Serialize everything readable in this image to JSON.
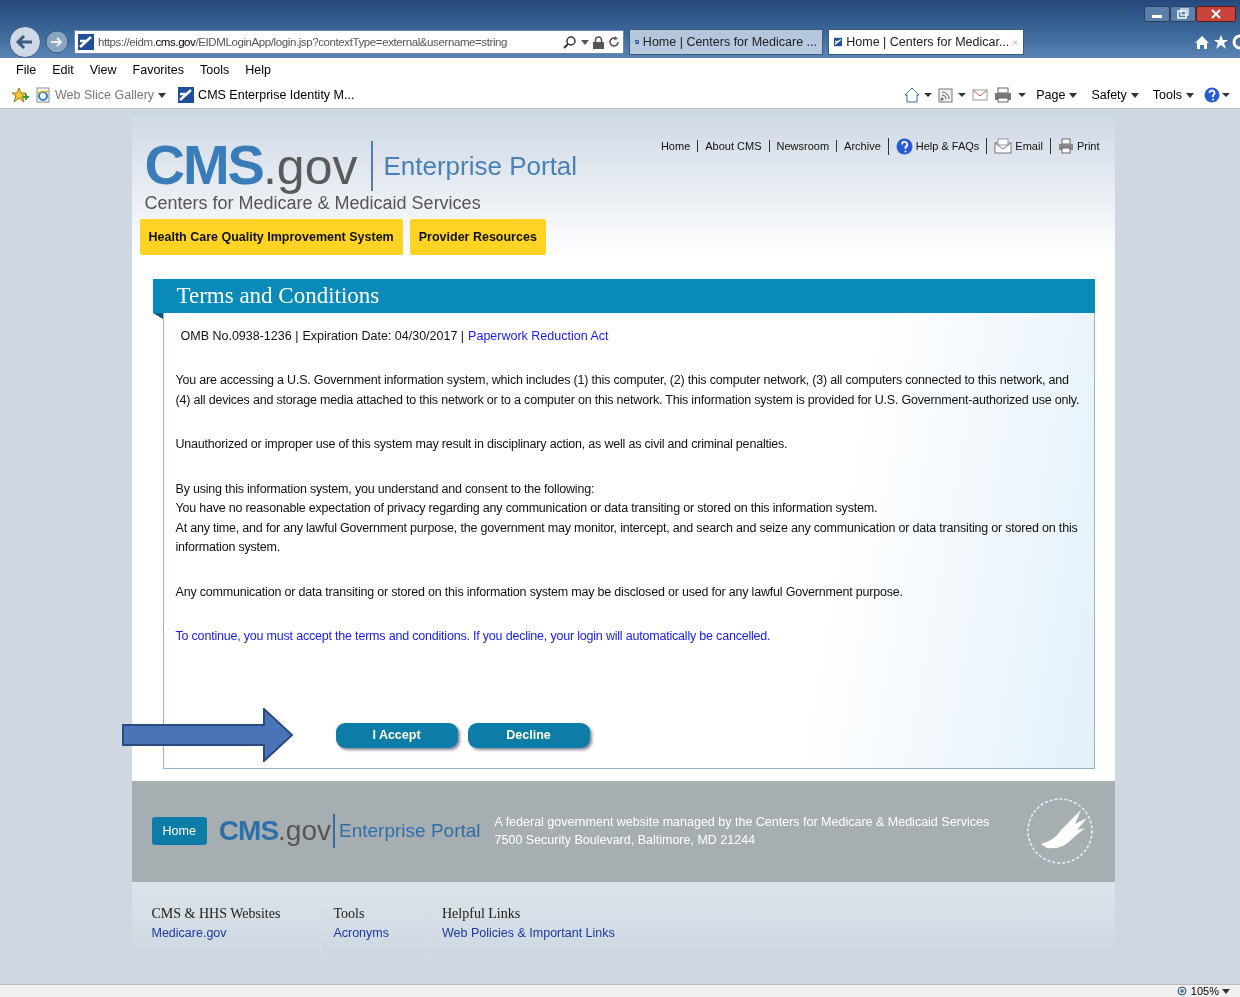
{
  "browser": {
    "address": {
      "prefix": "https://eidm.",
      "domain": "cms.gov",
      "path": "/EIDMLoginApp/login.jsp?contextType=external&username=string"
    },
    "tabs": [
      {
        "title": "Home | Centers for Medicare ...",
        "selected": false
      },
      {
        "title": "Home | Centers for Medicar...",
        "selected": true
      }
    ],
    "menu": [
      "File",
      "Edit",
      "View",
      "Favorites",
      "Tools",
      "Help"
    ],
    "favorites": [
      {
        "label": "Web Slice Gallery",
        "kind": "gallery"
      },
      {
        "label": "CMS Enterprise Identity M...",
        "kind": "site"
      }
    ],
    "commands": [
      "Page",
      "Safety",
      "Tools"
    ]
  },
  "header": {
    "logo": {
      "brand": "CMS",
      "suffix": ".gov",
      "portal": "Enterprise Portal",
      "subtitle": "Centers for Medicare & Medicaid Services"
    },
    "nav": [
      {
        "label": "Home",
        "kind": "text"
      },
      {
        "label": "About CMS",
        "kind": "text"
      },
      {
        "label": "Newsroom",
        "kind": "text"
      },
      {
        "label": "Archive",
        "kind": "text"
      },
      {
        "label": "Help & FAQs",
        "kind": "help"
      },
      {
        "label": "Email",
        "kind": "email"
      },
      {
        "label": "Print",
        "kind": "print"
      }
    ],
    "sections": [
      "Health Care Quality Improvement System",
      "Provider Resources"
    ]
  },
  "terms": {
    "title": "Terms and Conditions",
    "omb": "OMB No.0938-1236 |",
    "expiration": "Expiration Date: 04/30/2017 |",
    "link": "Paperwork Reduction Act",
    "paragraphs": [
      {
        "kind": "text",
        "lines": [
          "You are accessing a U.S. Government information system, which includes (1) this computer, (2) this computer network, (3) all computers connected to this network, and (4) all devices and storage media attached to this network or to a computer on this network. This information system is provided for U.S. Government-authorized use only."
        ]
      },
      {
        "kind": "text",
        "lines": [
          "Unauthorized or improper use of this system may result in disciplinary action, as well as civil and criminal penalties."
        ]
      },
      {
        "kind": "text",
        "lines": [
          "By using this information system, you understand and consent to the following:",
          "You have no reasonable expectation of privacy regarding any communication or data transiting or stored on this information system.",
          "At any time, and for any lawful Government purpose, the government may monitor, intercept, and search and seize any communication or data transiting or stored on this information system."
        ]
      },
      {
        "kind": "text",
        "lines": [
          "Any communication or data transiting or stored on this information system may be disclosed or used for any lawful Government purpose."
        ]
      },
      {
        "kind": "notice",
        "lines": [
          "To continue, you must accept the terms and conditions. If you decline, your login will automatically be cancelled."
        ]
      }
    ],
    "buttons": [
      "I Accept",
      "Decline"
    ]
  },
  "footer": {
    "home": "Home",
    "logo": {
      "brand": "CMS",
      "suffix": ".gov",
      "portal": "Enterprise Portal"
    },
    "lines": [
      "A federal government website managed by the Centers for Medicare & Medicaid Services",
      "7500 Security Boulevard, Baltimore, MD 21244"
    ],
    "columns": [
      {
        "heading": "CMS & HHS Websites",
        "link": "Medicare.gov"
      },
      {
        "heading": "Tools",
        "link": "Acronyms"
      },
      {
        "heading": "Helpful Links",
        "link": "Web Policies & Important Links"
      }
    ]
  },
  "status_bar": {
    "zoom": "105%"
  }
}
